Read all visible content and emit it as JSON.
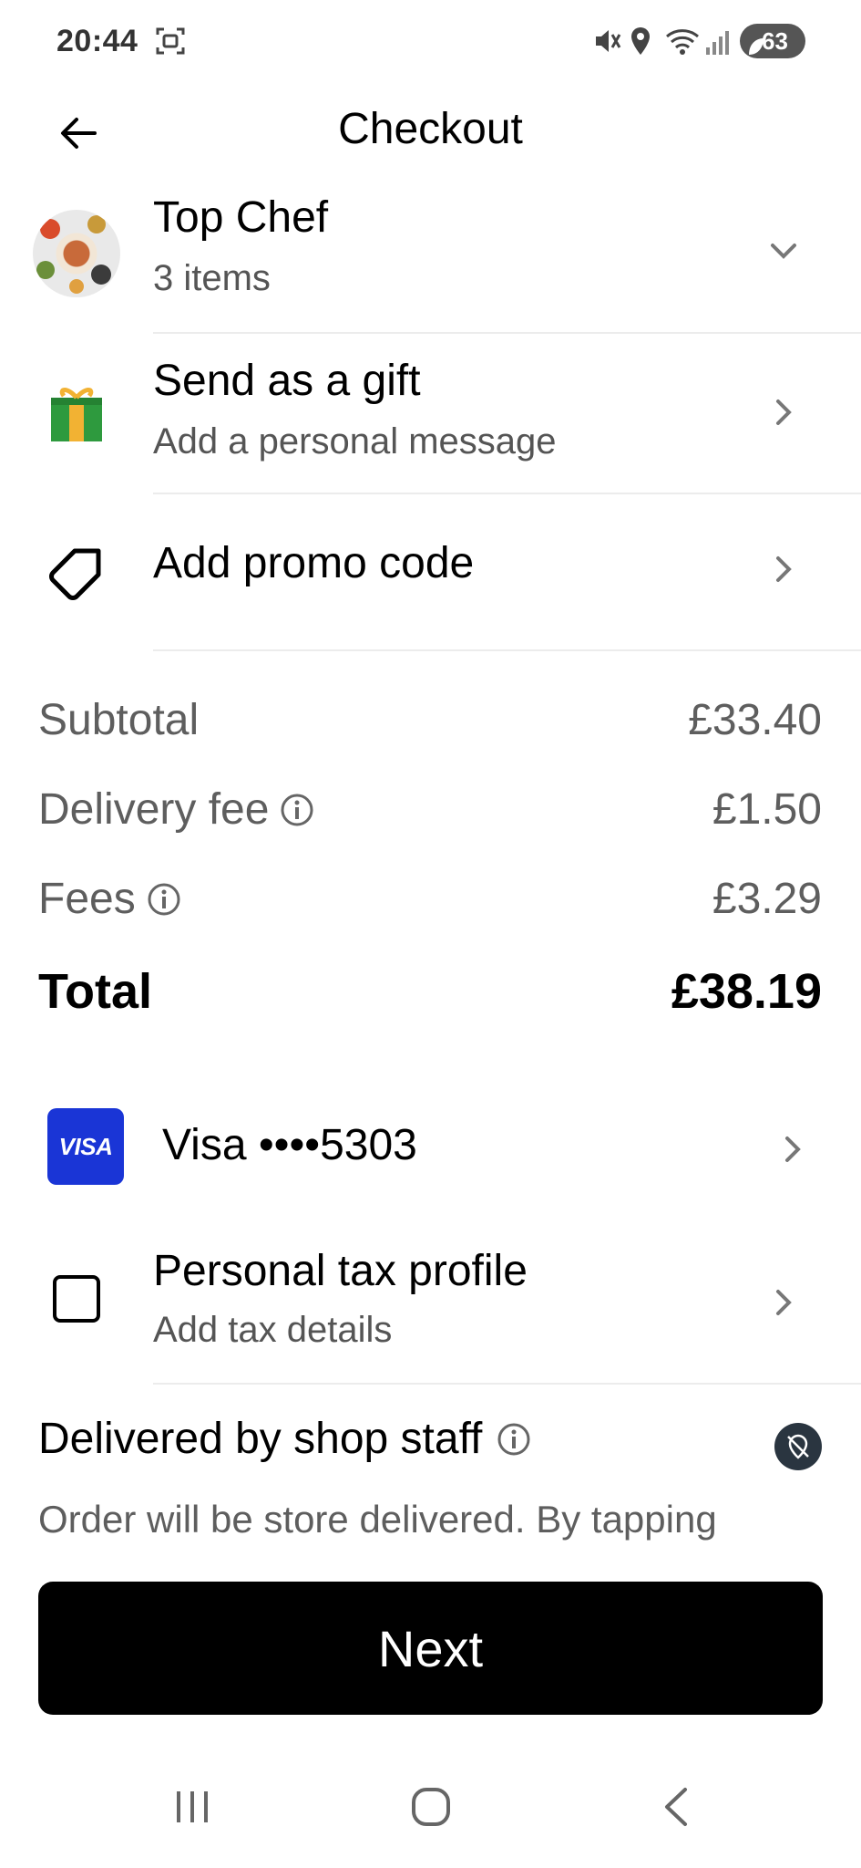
{
  "status_bar": {
    "time": "20:44",
    "battery": "63",
    "icons": [
      "screenshot-icon",
      "mute-icon",
      "location-icon",
      "wifi-icon",
      "signal-icon",
      "battery-icon"
    ]
  },
  "header": {
    "title": "Checkout",
    "back_icon": "arrow-left-icon"
  },
  "store": {
    "name": "Top Chef",
    "items": "3 items"
  },
  "gift": {
    "title": "Send as a gift",
    "subtitle": "Add a personal message"
  },
  "promo": {
    "title": "Add promo code"
  },
  "summary": {
    "subtotal_label": "Subtotal",
    "subtotal_value": "£33.40",
    "delivery_label": "Delivery fee",
    "delivery_value": "£1.50",
    "fees_label": "Fees",
    "fees_value": "£3.29",
    "total_label": "Total",
    "total_value": "£38.19"
  },
  "payment": {
    "card_brand": "VISA",
    "card_label": "Visa ••••5303",
    "brand_color": "#1a35d6"
  },
  "tax": {
    "title": "Personal tax profile",
    "subtitle": "Add tax details"
  },
  "delivery": {
    "title": "Delivered by shop staff",
    "text": "Order will be store delivered. By tapping"
  },
  "cta": {
    "label": "Next"
  },
  "navbar": {
    "icons": [
      "recents-icon",
      "home-icon",
      "back-icon"
    ]
  }
}
